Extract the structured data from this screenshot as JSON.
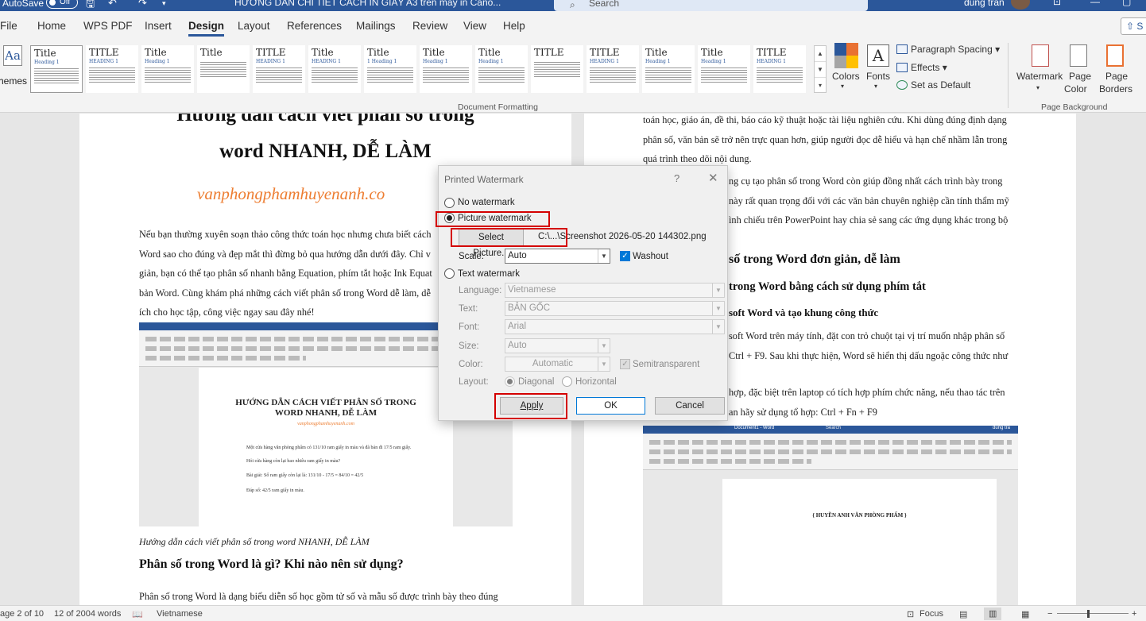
{
  "titlebar": {
    "autosave_label": "AutoSave",
    "autosave_state": "Off",
    "doc_title": "HƯỚNG DẪN CHI TIẾT CÁCH IN GIẤY A3 trên máy in Cano...",
    "search_placeholder": "Search",
    "user_name": "dung tran"
  },
  "menu": {
    "tabs": [
      "File",
      "Home",
      "WPS PDF",
      "Insert",
      "Design",
      "Layout",
      "References",
      "Mailings",
      "Review",
      "View",
      "Help"
    ],
    "active_tab": "Design"
  },
  "ribbon": {
    "themes_label": "hemes",
    "style_thumbs": [
      {
        "heading": "Title",
        "sub": "Heading 1"
      },
      {
        "heading": "TITLE",
        "sub": "HEADING 1"
      },
      {
        "heading": "Title",
        "sub": "Heading 1"
      },
      {
        "heading": "Title",
        "sub": ""
      },
      {
        "heading": "TITLE",
        "sub": "HEADING 1"
      },
      {
        "heading": "Title",
        "sub": "HEADING 1"
      },
      {
        "heading": "Title",
        "sub": "1 Heading 1"
      },
      {
        "heading": "Title",
        "sub": "Heading 1"
      },
      {
        "heading": "Title",
        "sub": "Heading 1"
      },
      {
        "heading": "TITLE",
        "sub": ""
      },
      {
        "heading": "TITLE",
        "sub": "HEADING 1"
      },
      {
        "heading": "Title",
        "sub": "Heading 1"
      },
      {
        "heading": "Title",
        "sub": "Heading 1"
      },
      {
        "heading": "TITLE",
        "sub": "HEADING 1"
      }
    ],
    "document_formatting_label": "Document Formatting",
    "colors_label": "Colors",
    "fonts_label": "Fonts",
    "paragraph_spacing_label": "Paragraph Spacing",
    "effects_label": "Effects",
    "set_as_default_label": "Set as Default",
    "watermark_label": "Watermark",
    "page_color_label_1": "Page",
    "page_color_label_2": "Color",
    "page_borders_label_1": "Page",
    "page_borders_label_2": "Borders",
    "page_background_label": "Page Background"
  },
  "left_page": {
    "title_line1": "Hướng dẫn cách viết phân số trong",
    "title_line2": "word NHANH, DỄ LÀM",
    "site": "vanphongphamhuyenanh.co",
    "paragraph_lines": [
      "Nếu bạn thường xuyên soạn thảo công thức toán học nhưng chưa biết cách",
      "Word sao cho đúng và đẹp mắt thì đừng bỏ qua hướng dẫn dưới đây. Chỉ v",
      "giản, bạn có thể tạo phân số nhanh bằng Equation, phím tắt hoặc Ink Equat",
      "bản Word. Cùng khám phá những cách viết phân số trong Word dễ làm, dễ",
      "ích cho học tập, công việc ngay sau đây nhé!"
    ],
    "embedded_title_1": "HƯỚNG DẪN CÁCH VIẾT PHÂN SỐ TRONG",
    "embedded_title_2": "WORD NHANH, DỄ LÀM",
    "embedded_site": "vanphongphamhuyenanh.com",
    "embedded_lines": [
      "Một cửa hàng văn phòng phẩm có 131/10 ram giấy in màu và đã bán đi 17/5 ram giấy.",
      "Hỏi cửa hàng còn lại bao nhiêu ram giấy in màu?",
      "Bài giải: Số ram giấy còn lại là: 131/10 - 17/5 = 84/10 = 42/5",
      "Đáp số: 42/5 ram giấy in màu."
    ],
    "caption": "Hướng dẫn cách viết phân số trong word NHANH, DỄ LÀM",
    "heading": "Phân số trong Word là gì? Khi nào nên sử dụng?",
    "last_line": "Phân số trong Word là dạng biểu diễn số học gồm tử số và mẫu số được trình bày theo đúng"
  },
  "right_page": {
    "para1_lines": [
      "toán học, giáo án, đề thi, báo cáo kỹ thuật hoặc tài liệu nghiên cứu. Khi dùng đúng định dạng",
      "phân số, văn bản sẽ trở nên trực quan hơn, giúp người đọc dễ hiểu và hạn chế nhầm lẫn trong",
      "quá trình theo dõi nội dung."
    ],
    "para2_lines": [
      "ng cụ tạo phân số trong Word còn giúp đồng nhất cách trình bày trong",
      "này rất quan trọng đối với các văn bản chuyên nghiệp cần tính thẩm mỹ",
      "ình chiếu trên PowerPoint hay chia sẻ sang các ứng dụng khác trong bộ"
    ],
    "heading2": "số trong Word đơn giản, dễ làm",
    "heading3": "trong Word bằng cách sử dụng phím tắt",
    "heading4": "soft Word và tạo khung công thức",
    "para3_lines": [
      "soft Word trên máy tính, đặt con trỏ chuột tại vị trí muốn nhập phân số",
      "Ctrl + F9. Sau khi thực hiện, Word sẽ hiển thị dấu ngoặc công thức như"
    ],
    "para4_lines": [
      "hợp, đặc biệt trên laptop có tích hợp phím chức năng, nếu thao tác trên",
      "an hãy sử dụng tổ hợp: Ctrl + Fn + F9"
    ],
    "embedded_doc_text": "{ HUYỀN ANH VĂN PHÒNG PHẨM }",
    "embedded_doc_title": "Document1 - Word",
    "embedded_search": "Search",
    "embedded_user": "dung tra"
  },
  "dialog": {
    "title": "Printed Watermark",
    "help": "?",
    "close": "✕",
    "no_watermark": "No watermark",
    "picture_watermark": "Picture watermark",
    "select_picture_button": "Select Picture...",
    "picture_path": "C:\\...\\Screenshot 2026-05-20 144302.png",
    "scale_label": "Scale:",
    "scale_value": "Auto",
    "washout_label": "Washout",
    "text_watermark": "Text watermark",
    "language_label": "Language:",
    "language_value": "Vietnamese",
    "text_label": "Text:",
    "text_value": "BẢN GỐC",
    "font_label": "Font:",
    "font_value": "Arial",
    "size_label": "Size:",
    "size_value": "Auto",
    "color_label": "Color:",
    "color_value": "Automatic",
    "semitransparent_label": "Semitransparent",
    "layout_label": "Layout:",
    "diagonal_label": "Diagonal",
    "horizontal_label": "Horizontal",
    "apply_button": "Apply",
    "ok_button": "OK",
    "cancel_button": "Cancel"
  },
  "statusbar": {
    "page": "age 2 of 10",
    "words": "12 of 2004 words",
    "language": "Vietnamese",
    "focus": "Focus"
  },
  "colors": {
    "accent": "#2b579a",
    "highlight_box": "#d40000",
    "site_orange": "#ed7d31"
  }
}
